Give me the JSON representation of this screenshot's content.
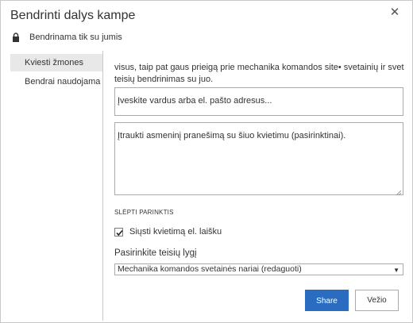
{
  "dialog": {
    "title": "Bendrinti dalys kampe",
    "close_icon": "close-icon",
    "sharing_status": "Bendrinama tik su jumis",
    "lock_icon": "lock-icon"
  },
  "nav": {
    "items": [
      {
        "label": "Kviesti žmones",
        "active": true
      },
      {
        "label": "Bendrai naudojama su",
        "active": false
      }
    ]
  },
  "invite": {
    "description_line1": "visus, taip pat gaus prieigą prie mechanika komandos site• svetainių ir svetainių,",
    "description_line2": "teisių bendrinimas su juo.",
    "people_placeholder": "Įveskite vardus arba el. pašto adresus...",
    "message_placeholder": "Įtraukti asmeninį pranešimą su šiuo kvietimu (pasirinktinai).",
    "hide_options": "SLĖPTI PARINKTIS",
    "send_email_label": "Siųsti kvietimą el. laišku",
    "send_email_checked": true,
    "permission_label": "Pasirinkite teisių lygį",
    "permission_value": "Mechanika komandos svetainės nariai (redaguoti)"
  },
  "buttons": {
    "share": "Share",
    "cancel": "Vežio"
  },
  "colors": {
    "accent": "#2a6cc0",
    "border": "#ababab",
    "nav_active": "#e8e8e8"
  }
}
